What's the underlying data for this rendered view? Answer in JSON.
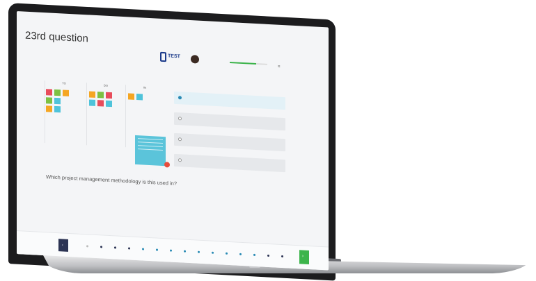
{
  "header": {
    "breadcrumb": "",
    "title": "23rd question",
    "logo_text": "TEST",
    "user_name": "",
    "user_subtitle": "",
    "progress_label": "",
    "progress_count": "",
    "progress_fraction": 0.7
  },
  "left_section_label": "",
  "right_section_label": "",
  "board": {
    "columns": [
      "TO",
      "DO",
      "IN"
    ]
  },
  "question_text": "Which project management methodology is this used in?",
  "answers": [
    {
      "label": "",
      "selected": true
    },
    {
      "label": "",
      "selected": false
    },
    {
      "label": "",
      "selected": false
    },
    {
      "label": "",
      "selected": false
    }
  ],
  "footer": {
    "prev_label": "‹",
    "next_label": "›"
  },
  "colors": {
    "accent_green": "#3cb44b",
    "dark_navy": "#2c3454",
    "note_red": "#e84c5b",
    "note_green": "#7dc142",
    "note_orange": "#f5a623",
    "note_blue": "#4fc3da"
  },
  "icons": {
    "menu": "hamburger-icon",
    "prev": "chevron-left-icon",
    "next": "chevron-right-icon"
  }
}
